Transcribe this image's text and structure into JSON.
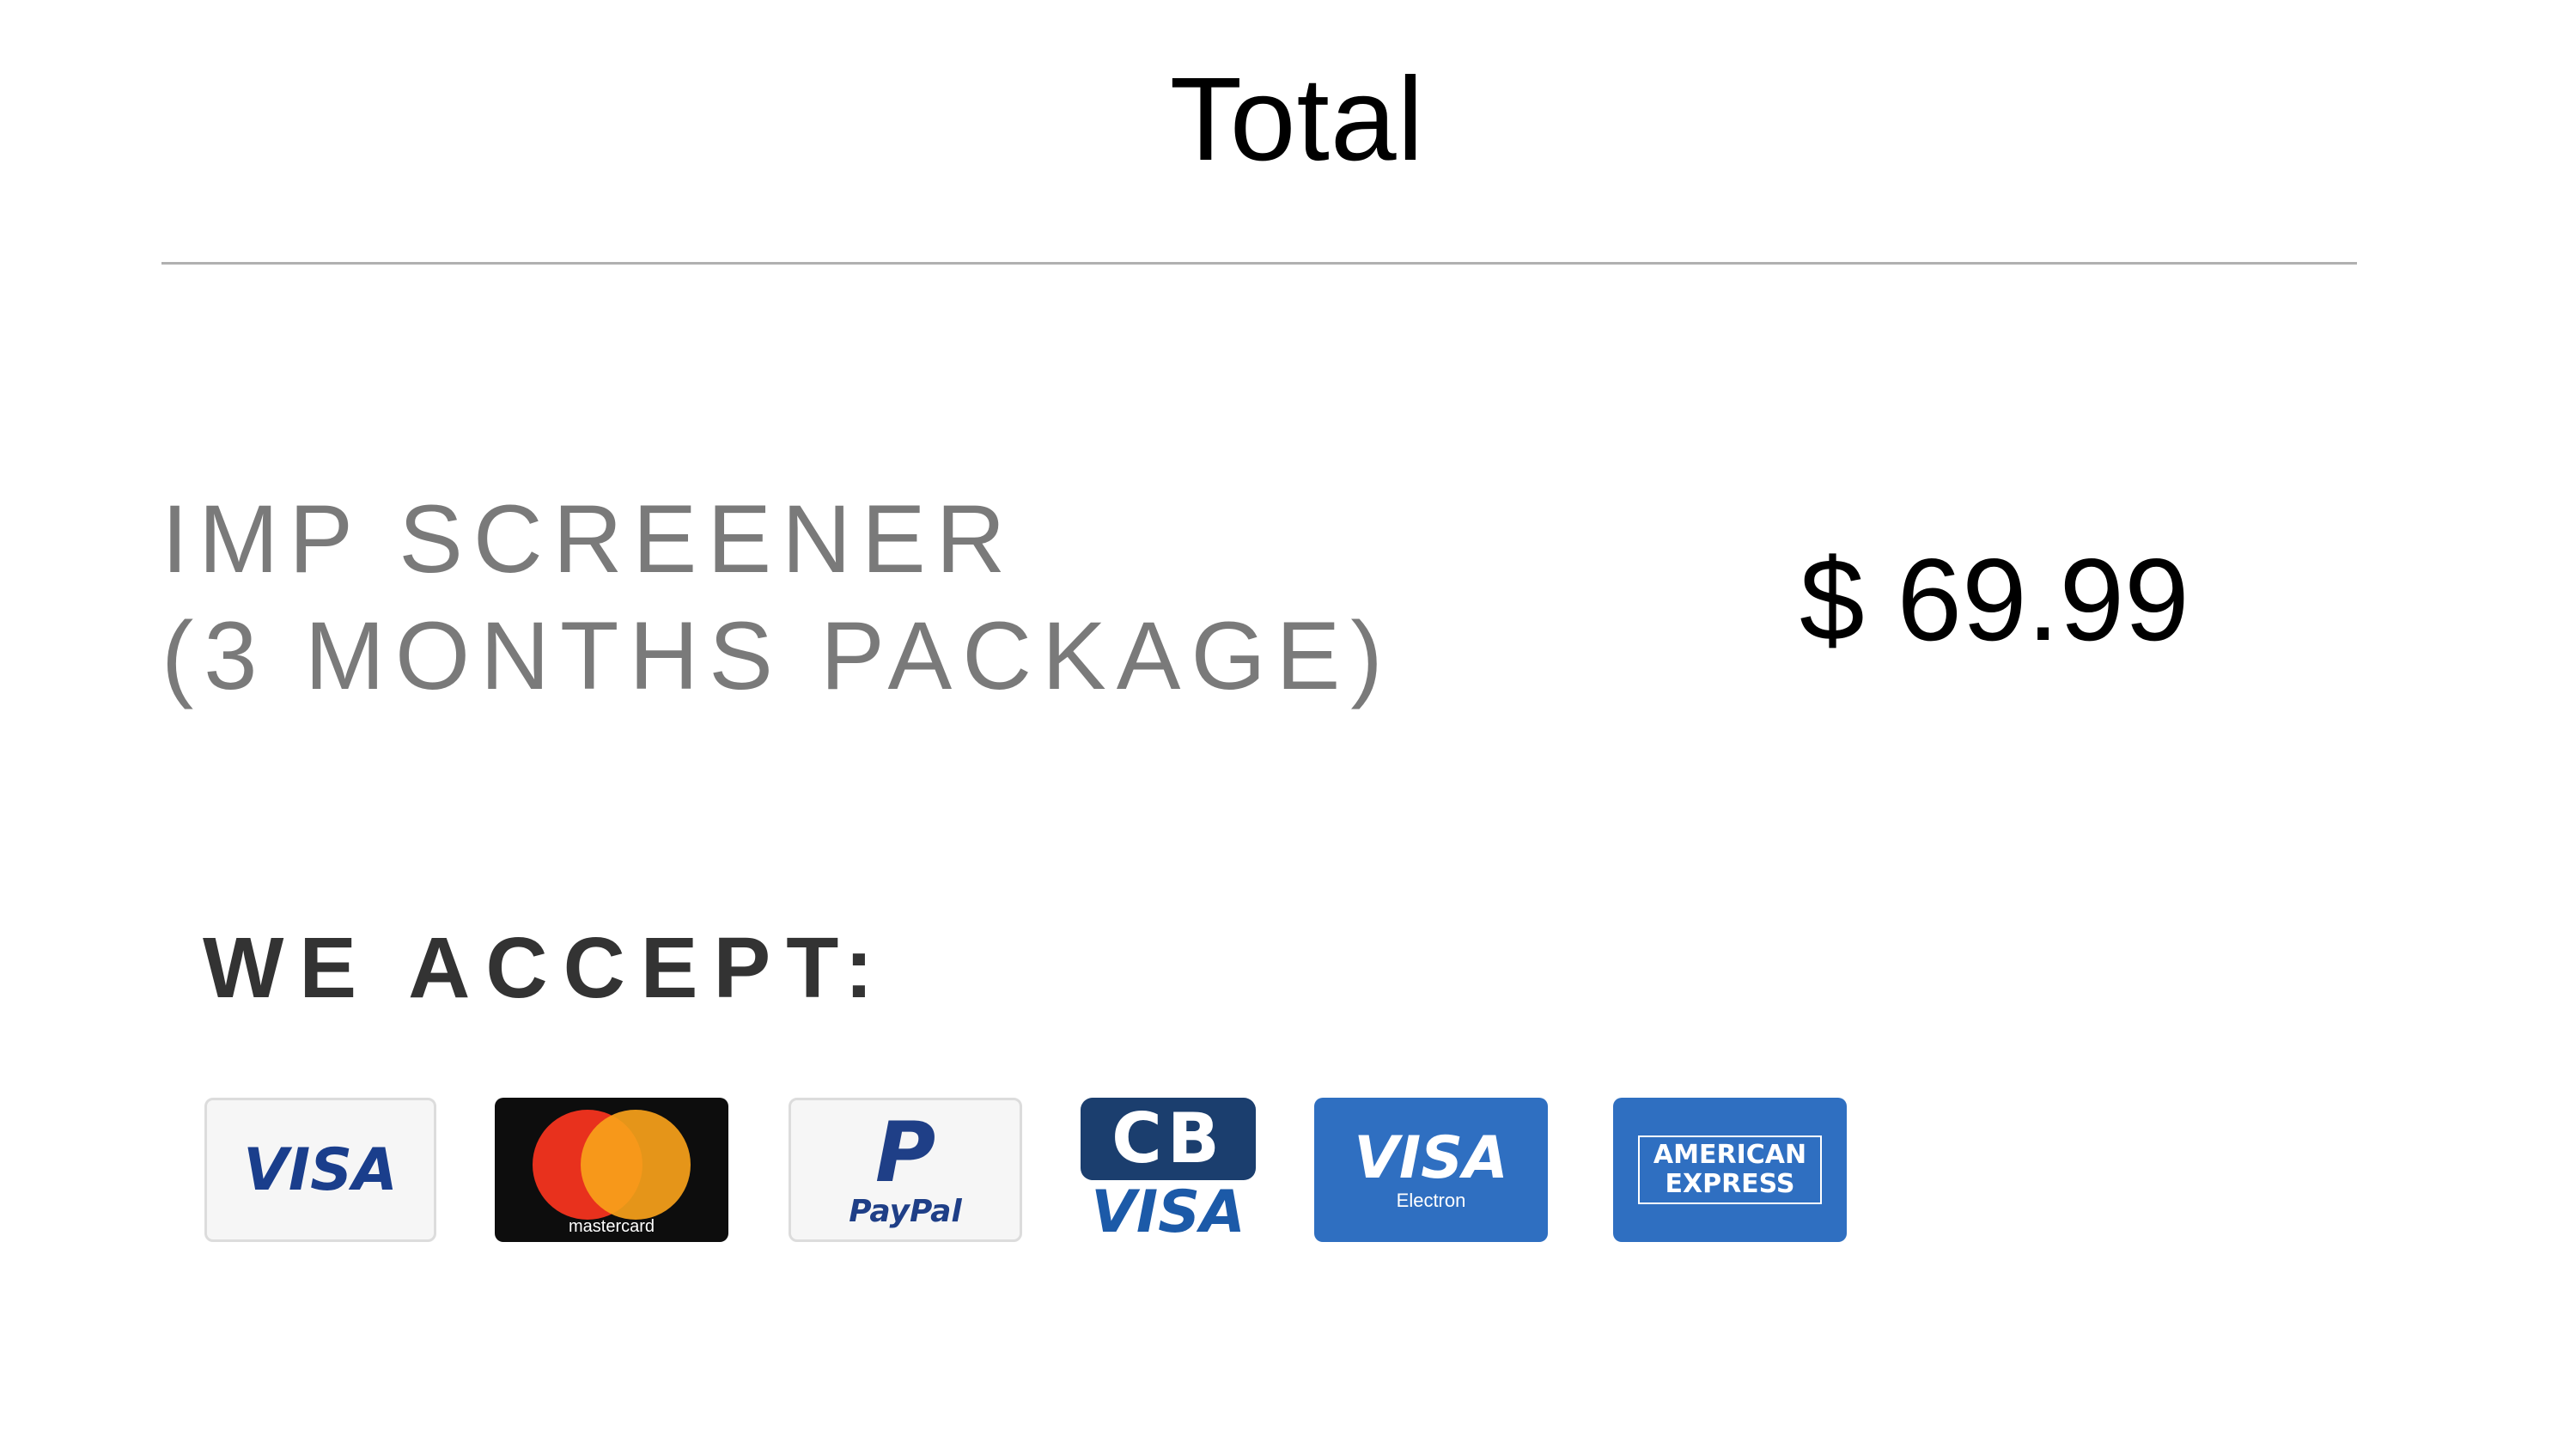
{
  "header": {
    "title": "Total"
  },
  "order": {
    "product_line1": "IMP SCREENER",
    "product_line2": "(3 MONTHS PACKAGE)",
    "price": "$ 69.99"
  },
  "payment": {
    "heading": "WE ACCEPT:",
    "methods": [
      {
        "name": "visa",
        "label": "VISA"
      },
      {
        "name": "mastercard",
        "label": "mastercard"
      },
      {
        "name": "paypal",
        "label": "PayPal"
      },
      {
        "name": "cb-visa",
        "label": "VISA",
        "badge": "CB"
      },
      {
        "name": "visa-electron",
        "label": "VISA",
        "sub": "Electron"
      },
      {
        "name": "american-express",
        "label": "AMERICAN EXPRESS"
      }
    ]
  },
  "colors": {
    "text_primary": "#000000",
    "text_muted": "#7a7a7a",
    "divider": "#b0b0b0",
    "visa_blue": "#1a3e8c",
    "card_blue": "#2f6fc1"
  }
}
